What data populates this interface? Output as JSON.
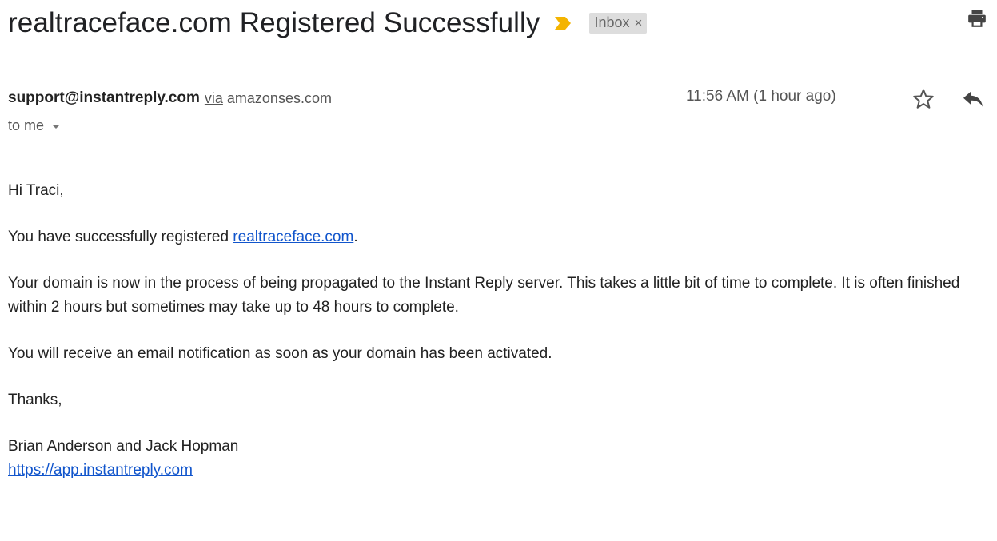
{
  "email": {
    "subject": "realtraceface.com Registered Successfully",
    "label": "Inbox",
    "label_remove": "×",
    "sender": "support@instantreply.com",
    "via_word": "via",
    "via_domain": "amazonses.com",
    "timestamp": "11:56 AM (1 hour ago)",
    "recipient": "to me",
    "importance_color": "#f4b400"
  },
  "body": {
    "greeting": "Hi Traci,",
    "registered_prefix": "You have successfully registered ",
    "registered_link": "realtraceface.com",
    "registered_suffix": ".",
    "propagation": "Your domain is now in the process of being propagated to the Instant Reply server. This takes a little bit of time to complete. It is often finished within 2 hours but sometimes may take up to 48 hours to complete.",
    "notification": "You will receive an email notification as soon as your domain has been activated.",
    "thanks": "Thanks,",
    "signature_names": "Brian Anderson and Jack Hopman",
    "signature_link": "https://app.instantreply.com"
  },
  "icons": {
    "importance": "importance-marker-icon",
    "print": "print-icon",
    "star": "star-icon",
    "reply": "reply-icon",
    "recipient_details": "chevron-down-icon"
  },
  "colors": {
    "link": "#1155cc",
    "label_bg": "#dddddd"
  }
}
